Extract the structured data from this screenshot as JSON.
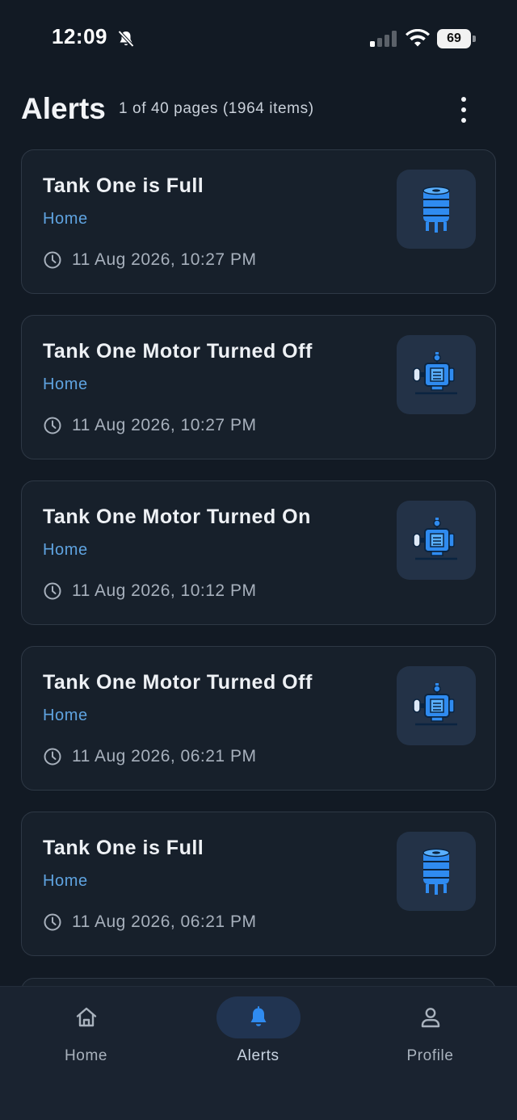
{
  "status_bar": {
    "time": "12:09",
    "battery": "69"
  },
  "header": {
    "title": "Alerts",
    "page_info": "1 of 40 pages (1964 items)"
  },
  "alerts": [
    {
      "title": "Tank One is Full",
      "location": "Home",
      "time": "11 Aug 2026, 10:27 PM",
      "icon": "water-tank-icon"
    },
    {
      "title": "Tank One Motor Turned Off",
      "location": "Home",
      "time": "11 Aug 2026, 10:27 PM",
      "icon": "water-pump-motor-icon"
    },
    {
      "title": "Tank One Motor Turned On",
      "location": "Home",
      "time": "11 Aug 2026, 10:12 PM",
      "icon": "water-pump-motor-icon"
    },
    {
      "title": "Tank One Motor Turned Off",
      "location": "Home",
      "time": "11 Aug 2026, 06:21 PM",
      "icon": "water-pump-motor-icon"
    },
    {
      "title": "Tank One is Full",
      "location": "Home",
      "time": "11 Aug 2026, 06:21 PM",
      "icon": "water-tank-icon"
    }
  ],
  "nav": {
    "items": [
      {
        "label": "Home",
        "icon": "home-icon",
        "active": false
      },
      {
        "label": "Alerts",
        "icon": "bell-icon",
        "active": true
      },
      {
        "label": "Profile",
        "icon": "person-icon",
        "active": false
      }
    ]
  },
  "colors": {
    "background": "#121a24",
    "card": "#17202b",
    "card_border": "#2e3845",
    "accent": "#5fa3e0",
    "active_nav": "#213451",
    "icon_blue": "#2f8bf0"
  }
}
